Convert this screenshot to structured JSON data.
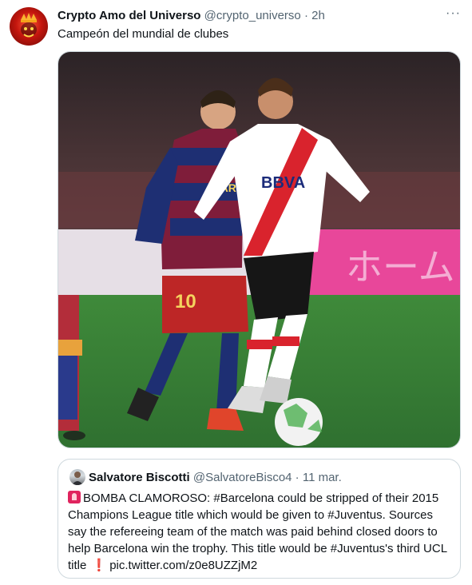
{
  "tweet": {
    "author_name": "Crypto Amo del Universo",
    "handle": "@crypto_universo",
    "separator": " · ",
    "time": "2h",
    "more_label": "···",
    "text": "Campeón del mundial de clubes",
    "media_alt": "Fotografía de partido de fútbol: jugador de River Plate con el balón perseguido por un jugador del Barcelona número 10"
  },
  "quote": {
    "author_name": "Salvatore Biscotti",
    "handle": "@SalvatoreBisco4",
    "separator": " · ",
    "date": "11 mar.",
    "text_main": "BOMBA CLAMOROSO: #Barcelona could be stripped of their 2015 Champions League title which would be given to #Juventus. Sources say the refereeing team of the match was paid behind closed doors to help Barcelona win the trophy. This title would be #Juventus's third UCL title",
    "exclaim": "❗",
    "link": "pic.twitter.com/z0e8UZZjM2"
  },
  "colors": {
    "text_primary": "#0f1419",
    "text_secondary": "#536471",
    "border": "#cfd9de",
    "siren": "#e0245e"
  },
  "icons": [
    "avatar-image",
    "more-icon",
    "siren-icon",
    "exclamation-icon"
  ]
}
